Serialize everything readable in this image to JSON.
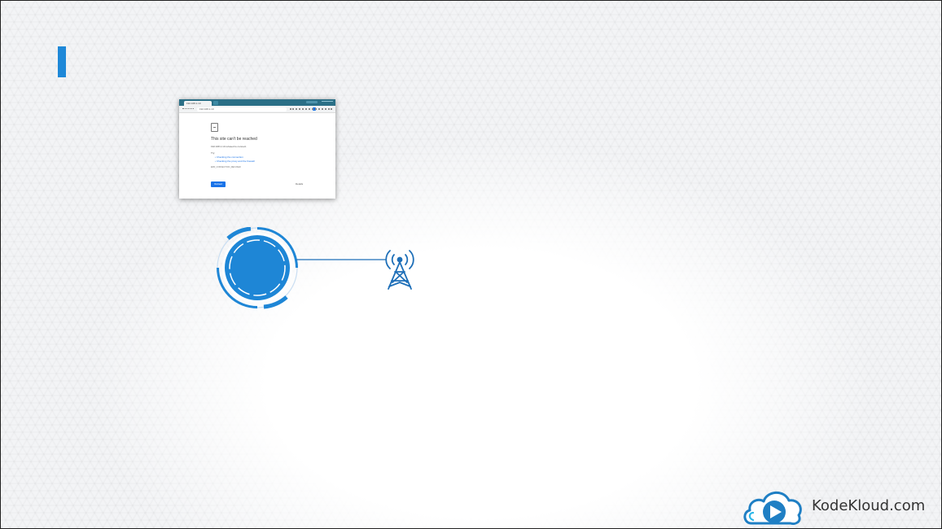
{
  "colors": {
    "accent": "#1e88d8",
    "node_fill": "#1e86d6",
    "tower": "#1e6fb8",
    "link_blue": "#1a73e8",
    "chrome_tabbar": "#2a6f86"
  },
  "browser": {
    "tab_title": "192.168.1.10",
    "address": "192.168.1.10",
    "error_title": "This site can't be reached",
    "error_subtitle": "192.168.1.10 refused to connect.",
    "try_label": "Try:",
    "suggestions": [
      "Checking the connection",
      "Checking the proxy and the firewall"
    ],
    "error_code": "ERR_CONNECTION_REFUSED",
    "reload_label": "Reload",
    "details_label": "Details"
  },
  "icons": {
    "error_page": "document-error-icon",
    "node": "node-circle-icon",
    "tower": "antenna-tower-icon",
    "logo": "kodekloud-logo-icon"
  },
  "brand": {
    "name": "KodeKloud.com"
  }
}
